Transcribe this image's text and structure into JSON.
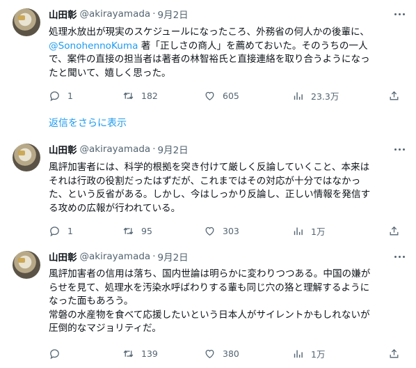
{
  "tweets": [
    {
      "name": "山田彰",
      "handle": "@akirayamada",
      "sep": "·",
      "date": "9月2日",
      "lines": [
        {
          "pre": "処理水放出が現実のスケジュールになったころ、外務省の何人かの後輩に、"
        },
        {
          "mention": "@SonohennoKuma",
          "post": " 著「正しさの商人」を薦めておいた。そのうちの一人"
        },
        {
          "pre": "で、案件の直接の担当者は著者の林智裕氏と直接連絡を取り合うようになっ"
        },
        {
          "pre": "たと聞いて、嬉しく思った。"
        }
      ],
      "replies": "1",
      "retweets": "182",
      "likes": "605",
      "views": "23.3万"
    },
    {
      "name": "山田彰",
      "handle": "@akirayamada",
      "sep": "·",
      "date": "9月2日",
      "lines": [
        {
          "pre": "風評加害者には、科学的根拠を突き付けて厳しく反論していくこと、本来は"
        },
        {
          "pre": "それは行政の役割だったはずだが、これまではその対応が十分ではなかっ"
        },
        {
          "pre": "た、という反省がある。しかし、今はしっかり反論し、正しい情報を発信す"
        },
        {
          "pre": "る攻めの広報が行われている。"
        }
      ],
      "replies": "1",
      "retweets": "95",
      "likes": "303",
      "views": "1万"
    },
    {
      "name": "山田彰",
      "handle": "@akirayamada",
      "sep": "·",
      "date": "9月2日",
      "lines": [
        {
          "pre": "風評加害者の信用は落ち、国内世論は明らかに変わりつつある。中国の嫌が"
        },
        {
          "pre": "らせを見て、処理水を汚染水呼ばわりする輩も同じ穴の狢と理解するように"
        },
        {
          "pre": "なった面もあろう。"
        },
        {
          "pre": "常磐の水産物を食べて応援したいという日本人がサイレントかもしれないが"
        },
        {
          "pre": "圧倒的なマジョリティだ。"
        }
      ],
      "replies": "",
      "retweets": "139",
      "likes": "380",
      "views": "1万"
    }
  ],
  "show_more_replies": "返信をさらに表示",
  "colors": {
    "text": "#0f1419",
    "secondary": "#536471",
    "link": "#1d9bf0"
  },
  "icons": [
    "reply-icon",
    "retweet-icon",
    "like-icon",
    "views-icon",
    "share-icon",
    "more-icon"
  ]
}
